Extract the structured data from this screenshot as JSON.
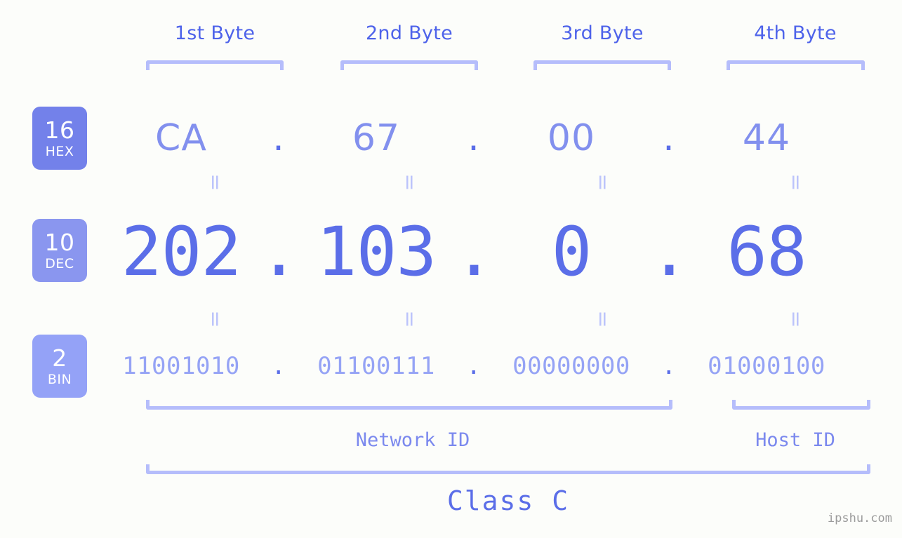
{
  "ip": {
    "decimal": "202.103.0.68",
    "class": "Class C"
  },
  "byte_headers": [
    {
      "label": "1st Byte"
    },
    {
      "label": "2nd Byte"
    },
    {
      "label": "3rd Byte"
    },
    {
      "label": "4th Byte"
    }
  ],
  "rows": {
    "hex": {
      "badge_base": "16",
      "badge_system": "HEX",
      "values": [
        "CA",
        "67",
        "00",
        "44"
      ],
      "separator": "."
    },
    "dec": {
      "badge_base": "10",
      "badge_system": "DEC",
      "values": [
        "202",
        "103",
        "0",
        "68"
      ],
      "separator": "."
    },
    "bin": {
      "badge_base": "2",
      "badge_system": "BIN",
      "values": [
        "11001010",
        "01100111",
        "00000000",
        "01000100"
      ],
      "separator": "."
    }
  },
  "equals_mark": "=",
  "sections": {
    "network_id": "Network ID",
    "host_id": "Host ID",
    "class": "Class C"
  },
  "watermark": "ipshu.com",
  "colors": {
    "background": "#fcfdfa",
    "bracket": "#b5bdfb",
    "hex_text": "#8290ee",
    "dec_text": "#5b6ee8",
    "bin_text": "#95a3f5",
    "badge_hex": "#7381ea",
    "badge_dec": "#8a96ef",
    "badge_bin": "#94a2f7",
    "header_text": "#4e63ea",
    "section_text": "#7b89ee",
    "watermark_text": "#9b9b9b"
  }
}
